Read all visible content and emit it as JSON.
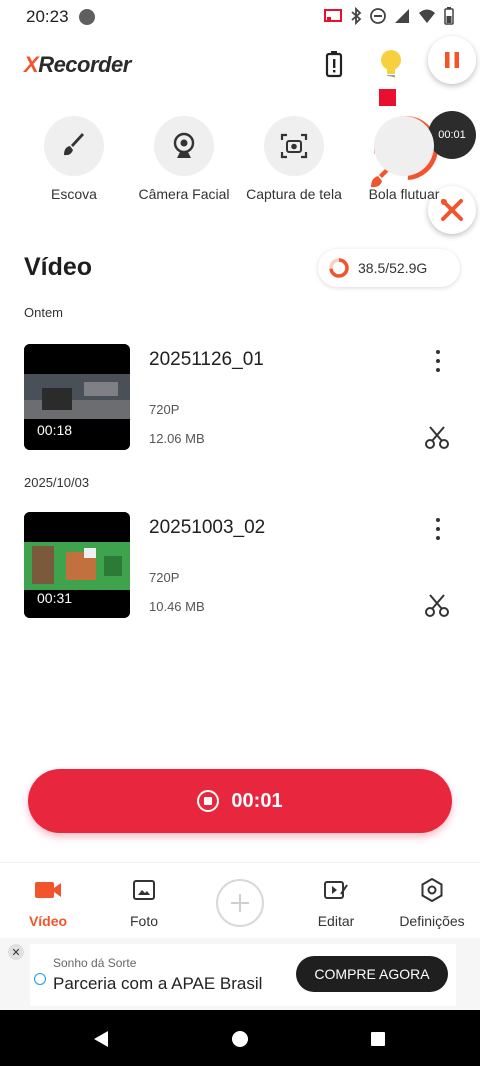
{
  "status_bar": {
    "time": "20:23"
  },
  "app": {
    "logo_x": "X",
    "logo_rest": "Recorder"
  },
  "floating": {
    "timer": "00:01"
  },
  "tools": [
    {
      "label": "Escova",
      "icon": "brush-icon"
    },
    {
      "label": "Câmera Facial",
      "icon": "webcam-icon"
    },
    {
      "label": "Captura de tela",
      "icon": "screenshot-icon"
    },
    {
      "label": "Bola flutuar",
      "icon": "floating-ball-icon"
    }
  ],
  "section": {
    "title": "Vídeo"
  },
  "storage": {
    "text": "38.5/52.9G",
    "used_fraction": 0.73
  },
  "groups": [
    {
      "label": "Ontem",
      "video": {
        "name": "20251126_01",
        "duration": "00:18",
        "resolution": "720P",
        "size": "12.06 MB"
      }
    },
    {
      "label": "2025/10/03",
      "video": {
        "name": "20251003_02",
        "duration": "00:31",
        "resolution": "720P",
        "size": "10.46 MB"
      }
    }
  ],
  "record": {
    "time": "00:01"
  },
  "bottom_nav": {
    "video": "Vídeo",
    "photo": "Foto",
    "edit": "Editar",
    "settings": "Definições"
  },
  "ad": {
    "brand": "Sonho dá Sorte",
    "headline": "Parceria com a APAE Brasil",
    "cta": "COMPRE AGORA"
  },
  "colors": {
    "accent": "#f2542d",
    "record": "#e8273f",
    "stop": "#e8102e"
  }
}
